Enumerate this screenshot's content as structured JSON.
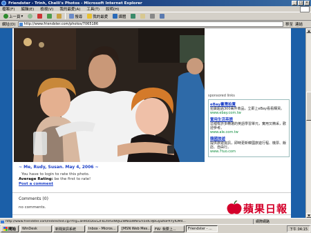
{
  "window": {
    "title": "Friendster - Trinh, Chelli's Photos - Microsoft Internet Explorer"
  },
  "menu": {
    "items": [
      "檔案(F)",
      "編輯(E)",
      "檢視(V)",
      "我的最愛(A)",
      "工具(T)",
      "說明(H)"
    ]
  },
  "toolbar": {
    "back": "上一頁",
    "search": "搜尋",
    "favorites": "我的最愛",
    "media": "媒體"
  },
  "address": {
    "label": "網址(D)",
    "url": "http://www.friendster.com/photos/7065186",
    "go": "移至",
    "links": "連結"
  },
  "sidebar": {
    "header": "sponsored links",
    "ads": [
      {
        "title": "eBay臺灣拍賣",
        "desc": "拍賣超過300萬件商品，立即上eBay看看購買。",
        "url": "www.ebay.com.tw"
      },
      {
        "title": "實用生活英語",
        "desc": "這裡有許多精選的英語學習單元，實用又精采，歡迎參考。",
        "url": "www.ale.com.tw"
      },
      {
        "title": "韓國旅遊",
        "desc": "提供旅遊資訊，即時更新韓國旅遊行程、機票、飯店、自由行。",
        "url": "www.7tuo.com"
      }
    ]
  },
  "photo": {
    "caption": "~ Me, Rudy, Susan. May 4, 2006 ~",
    "rate_prompt": "You have to login to rate this photo.",
    "avg_label": "Average Rating:",
    "avg_value": "be the first to rate!",
    "post_comment": "Post a comment"
  },
  "comments": {
    "heading": "Comments (0)",
    "empty": "no comments."
  },
  "watermark": {
    "text": "蘋果日報"
  },
  "status": {
    "url": "http://www.friendster.com/redirected.cgi?rtrg=aHR0cDovL2FkLmRvdWJsZWNsaWNrLm5ldC9jbGljaztoPXYyfDM4...",
    "zone": "網際網路"
  },
  "taskbar": {
    "start": "開始",
    "tasks": [
      "WinDesk",
      "新聞資訊系統",
      "Inbox - Micros...",
      "[MSN Web Mes...",
      "FW: 我要上...",
      "Friendster - ..."
    ],
    "clock": "下午 04:15"
  },
  "colors": {
    "page_bg": "#1b5fa8",
    "link": "#1a3ec8",
    "ad_url": "#0a8a3a",
    "watermark": "#d4002a"
  }
}
